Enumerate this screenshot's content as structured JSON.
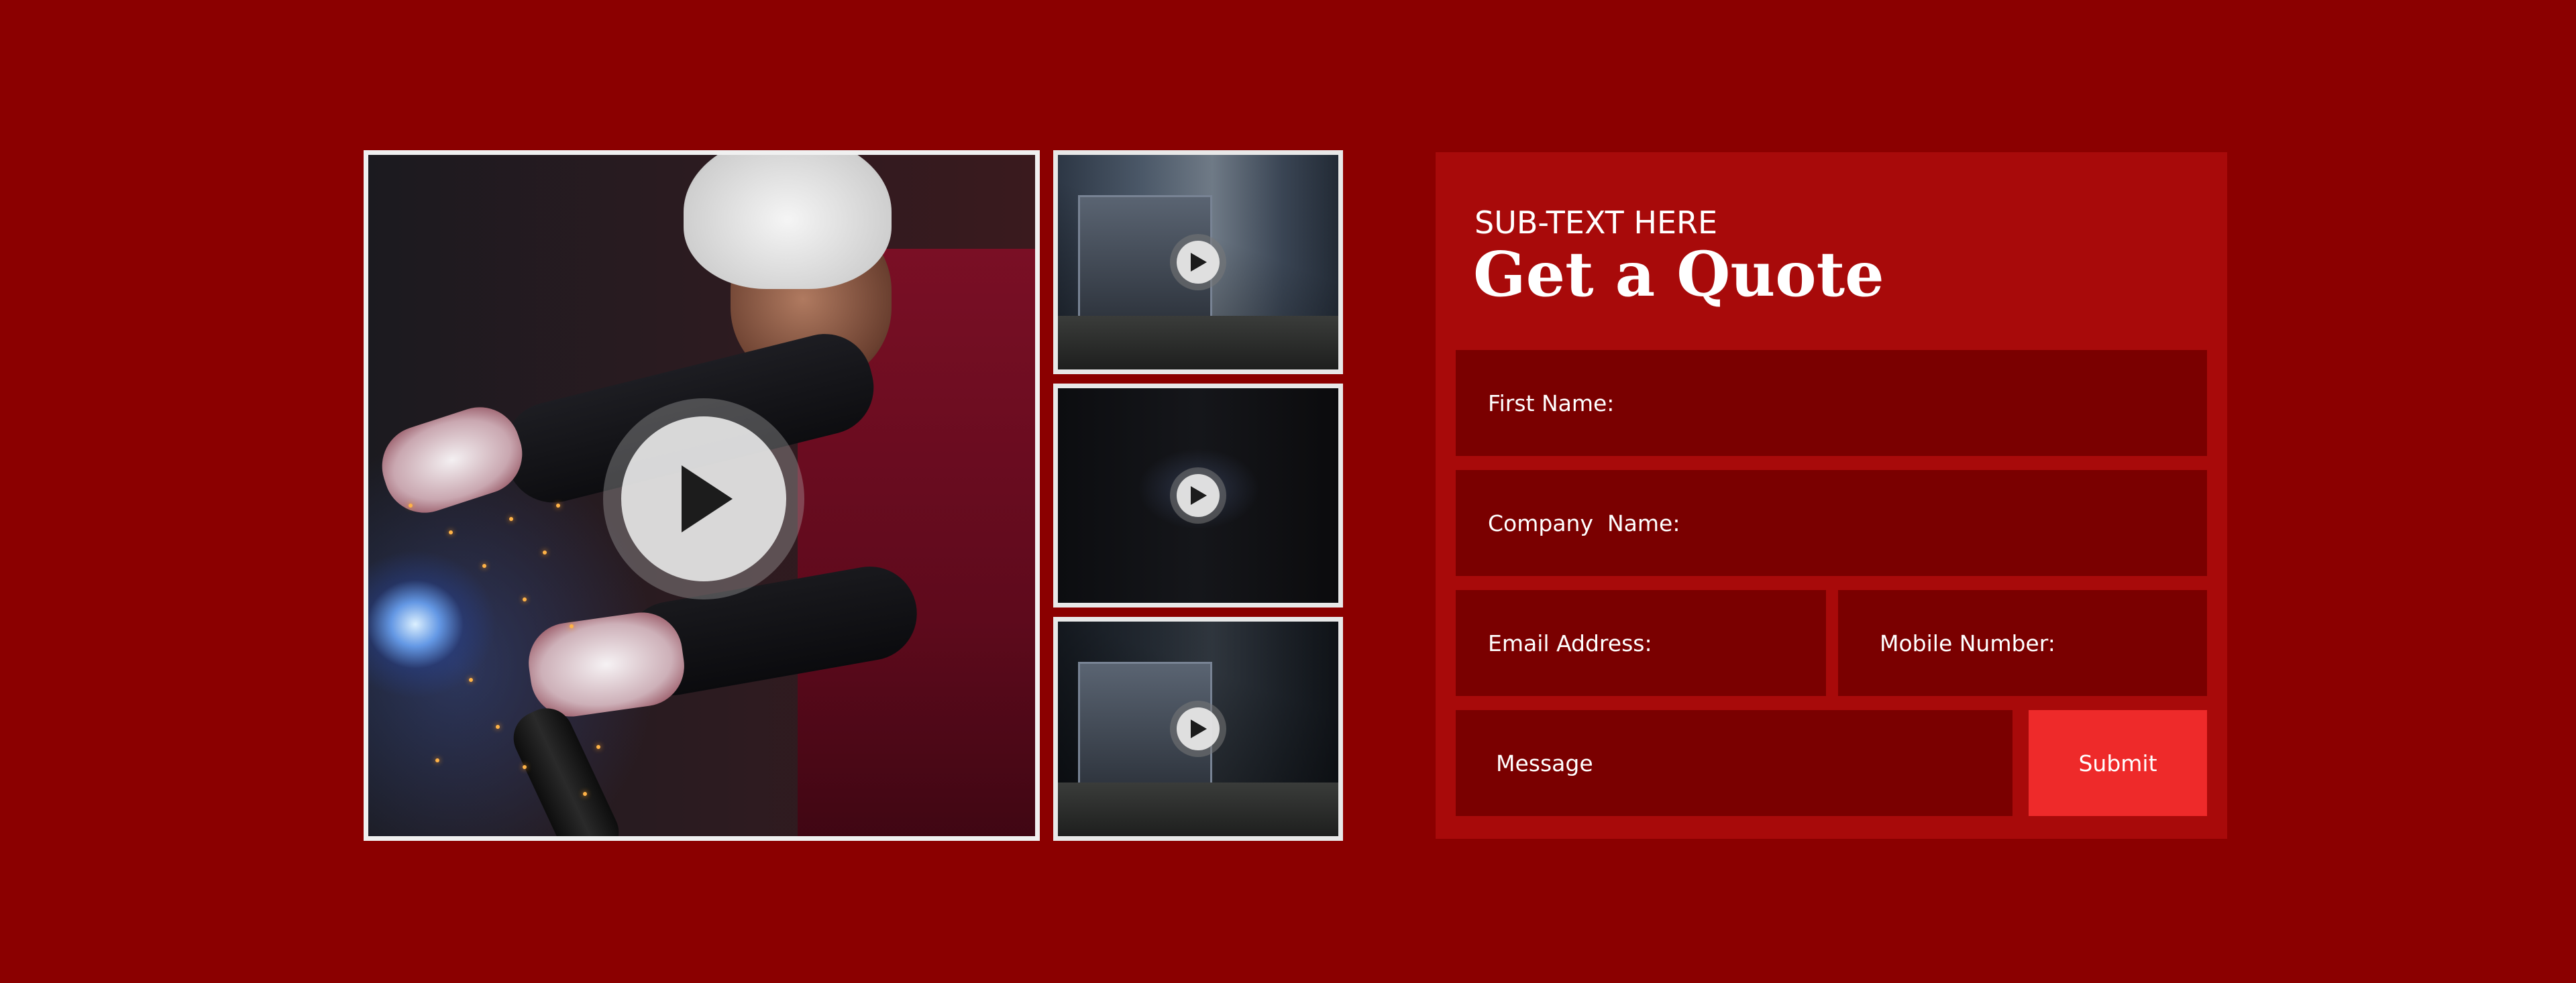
{
  "media": {
    "main_video": {
      "icon": "play-icon"
    },
    "thumbnails": [
      {
        "icon": "play-icon"
      },
      {
        "icon": "play-icon"
      },
      {
        "icon": "play-icon"
      }
    ]
  },
  "quote_form": {
    "subtext": "SUB-TEXT HERE",
    "title": "Get a Quote",
    "first_name_label": "First Name:",
    "company_name_label": "Company  Name:",
    "email_label": "Email Address:",
    "mobile_label": "Mobile Number:",
    "message_label": "Message",
    "submit_label": "Submit"
  },
  "colors": {
    "page_background": "#8b0000",
    "panel_background": "#a80a0a",
    "field_background": "#7a0000",
    "submit_background": "#ee2a2a"
  }
}
